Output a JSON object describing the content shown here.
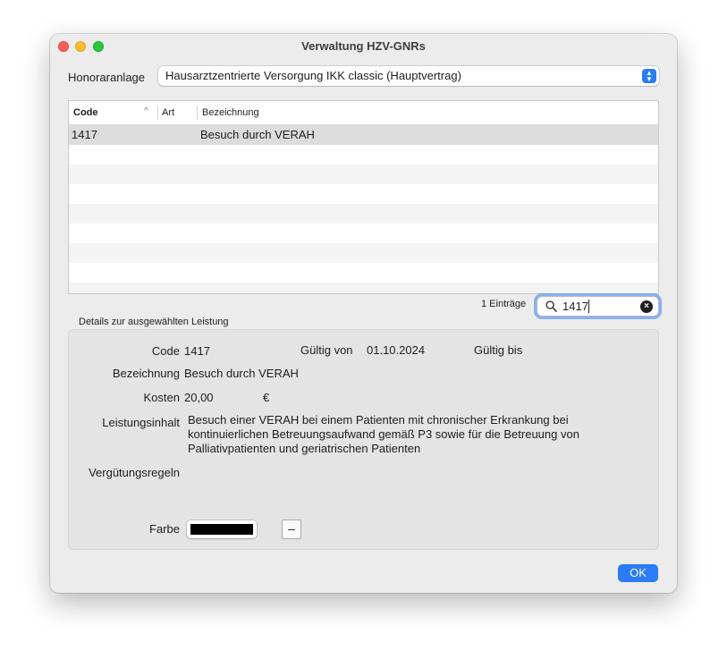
{
  "window": {
    "title": "Verwaltung HZV-GNRs"
  },
  "honoraranlage": {
    "label": "Honoraranlage",
    "selected": "Hausarztzentrierte Versorgung IKK classic (Hauptvertrag)"
  },
  "table": {
    "columns": [
      "Code",
      "Art",
      "Bezeichnung"
    ],
    "rows": [
      {
        "code": "1417",
        "art": "",
        "bezeichnung": "Besuch durch VERAH"
      }
    ]
  },
  "footer": {
    "count": "1 Einträge"
  },
  "search": {
    "value": "1417"
  },
  "details": {
    "group_label": "Details zur ausgewählten Leistung",
    "code_label": "Code",
    "code_value": "1417",
    "gueltig_von_label": "Gültig von",
    "gueltig_von_value": "01.10.2024",
    "gueltig_bis_label": "Gültig bis",
    "bezeichnung_label": "Bezeichnung",
    "bezeichnung_value": "Besuch durch VERAH",
    "kosten_label": "Kosten",
    "kosten_value": "20,00",
    "kosten_unit": "€",
    "leistungsinhalt_label": "Leistungsinhalt",
    "leistungsinhalt_lines": [
      "Besuch einer VERAH bei einem Patienten mit chronischer Erkrankung bei",
      "kontinuierlichen Betreuungsaufwand gemäß P3 sowie für die Betreuung von",
      "Palliativpatienten und  geriatrischen Patienten"
    ],
    "verguetungsregeln_label": "Vergütungsregeln",
    "farbe_label": "Farbe",
    "farbe_value": "#000000",
    "minus_label": "–"
  },
  "buttons": {
    "ok": "OK"
  },
  "colors": {
    "accent": "#2b7cf6",
    "selection": "#dcdcdc"
  },
  "icons": {
    "search": "search-icon",
    "clear": "clear-icon",
    "select": "chevron-updown-icon",
    "sort": "sort-ascending-icon"
  }
}
